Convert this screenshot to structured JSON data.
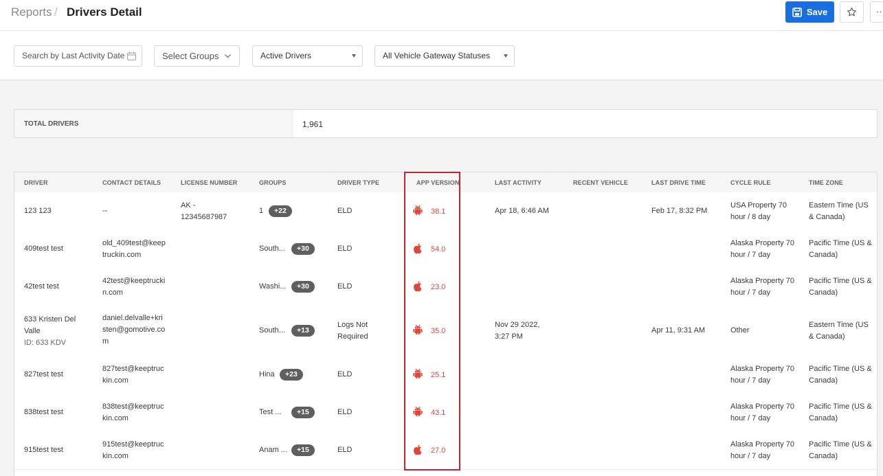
{
  "header": {
    "breadcrumb_root": "Reports",
    "breadcrumb_sep": "/",
    "page_title": "Drivers Detail",
    "save_label": "Save",
    "more_label": "···"
  },
  "filters": {
    "last_activity_placeholder": "Search by Last Activity Date",
    "groups_placeholder": "Select Groups",
    "driver_status": "Active Drivers",
    "gateway_status": "All Vehicle Gateway Statuses"
  },
  "summary": {
    "total_label": "TOTAL DRIVERS",
    "total_value": "1,961"
  },
  "table": {
    "columns": [
      "DRIVER",
      "CONTACT DETAILS",
      "LICENSE NUMBER",
      "GROUPS",
      "DRIVER TYPE",
      "APP VERSION",
      "LAST ACTIVITY",
      "RECENT VEHICLE",
      "LAST DRIVE TIME",
      "CYCLE RULE",
      "TIME ZONE"
    ],
    "rows": [
      {
        "driver": "123 123",
        "driver_id": "",
        "contact": "--",
        "license": "AK - 12345687987",
        "group": "1",
        "group_more": "+22",
        "type": "ELD",
        "os": "android",
        "app_version": "38.1",
        "last_activity": "Apr 18, 6:46 AM",
        "recent_vehicle": "",
        "last_drive": "Feb 17, 8:32 PM",
        "cycle": "USA Property 70 hour / 8 day",
        "tz": "Eastern Time (US & Canada)"
      },
      {
        "driver": "409test test",
        "driver_id": "",
        "contact": "old_409test@keeptruckin.com",
        "license": "",
        "group": "South...",
        "group_more": "+30",
        "type": "ELD",
        "os": "apple",
        "app_version": "54.0",
        "last_activity": "",
        "recent_vehicle": "",
        "last_drive": "",
        "cycle": "Alaska Property 70 hour / 7 day",
        "tz": "Pacific Time (US & Canada)"
      },
      {
        "driver": "42test test",
        "driver_id": "",
        "contact": "42test@keeptruckin.com",
        "license": "",
        "group": "Washi...",
        "group_more": "+30",
        "type": "ELD",
        "os": "apple",
        "app_version": "23.0",
        "last_activity": "",
        "recent_vehicle": "",
        "last_drive": "",
        "cycle": "Alaska Property 70 hour / 7 day",
        "tz": "Pacific Time (US & Canada)"
      },
      {
        "driver": "633 Kristen Del Valle",
        "driver_id": "ID: 633 KDV",
        "contact": "daniel.delvalle+kristen@gomotive.com",
        "license": "",
        "group": "South...",
        "group_more": "+13",
        "type": "Logs Not Required",
        "os": "android",
        "app_version": "35.0",
        "last_activity": "Nov 29 2022, 3:27 PM",
        "recent_vehicle": "",
        "last_drive": "Apr 11, 9:31 AM",
        "cycle": "Other",
        "tz": "Eastern Time (US & Canada)"
      },
      {
        "driver": "827test test",
        "driver_id": "",
        "contact": "827test@keeptruckin.com",
        "license": "",
        "group": "Hina",
        "group_more": "+23",
        "type": "ELD",
        "os": "android",
        "app_version": "25.1",
        "last_activity": "",
        "recent_vehicle": "",
        "last_drive": "",
        "cycle": "Alaska Property 70 hour / 7 day",
        "tz": "Pacific Time (US & Canada)"
      },
      {
        "driver": "838test test",
        "driver_id": "",
        "contact": "838test@keeptruckin.com",
        "license": "",
        "group": "Test ...",
        "group_more": "+15",
        "type": "ELD",
        "os": "android",
        "app_version": "43.1",
        "last_activity": "",
        "recent_vehicle": "",
        "last_drive": "",
        "cycle": "Alaska Property 70 hour / 7 day",
        "tz": "Pacific Time (US & Canada)"
      },
      {
        "driver": "915test test",
        "driver_id": "",
        "contact": "915test@keeptruckin.com",
        "license": "",
        "group": "Anam ...",
        "group_more": "+15",
        "type": "ELD",
        "os": "apple",
        "app_version": "27.0",
        "last_activity": "",
        "recent_vehicle": "",
        "last_drive": "",
        "cycle": "Alaska Property 70 hour / 7 day",
        "tz": "Pacific Time (US & Canada)"
      }
    ]
  },
  "colors": {
    "primary": "#1a6fe0",
    "app_version": "#e0453a",
    "highlight": "#c6262a",
    "pill": "#5f5f5f"
  }
}
